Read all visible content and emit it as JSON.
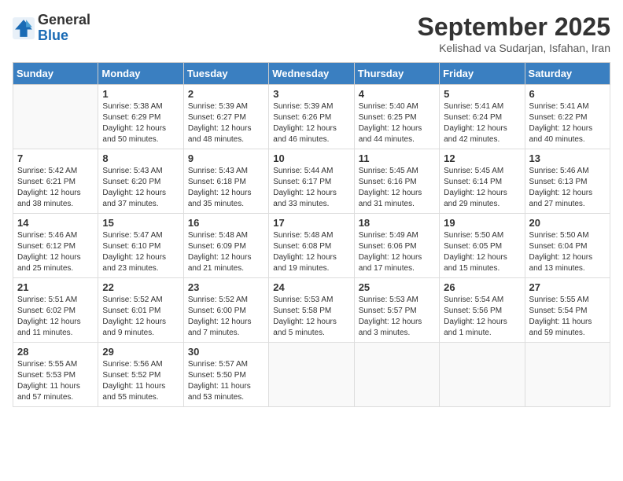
{
  "header": {
    "logo_line1": "General",
    "logo_line2": "Blue",
    "month": "September 2025",
    "location": "Kelishad va Sudarjan, Isfahan, Iran"
  },
  "weekdays": [
    "Sunday",
    "Monday",
    "Tuesday",
    "Wednesday",
    "Thursday",
    "Friday",
    "Saturday"
  ],
  "weeks": [
    [
      {
        "day": "",
        "text": ""
      },
      {
        "day": "1",
        "text": "Sunrise: 5:38 AM\nSunset: 6:29 PM\nDaylight: 12 hours\nand 50 minutes."
      },
      {
        "day": "2",
        "text": "Sunrise: 5:39 AM\nSunset: 6:27 PM\nDaylight: 12 hours\nand 48 minutes."
      },
      {
        "day": "3",
        "text": "Sunrise: 5:39 AM\nSunset: 6:26 PM\nDaylight: 12 hours\nand 46 minutes."
      },
      {
        "day": "4",
        "text": "Sunrise: 5:40 AM\nSunset: 6:25 PM\nDaylight: 12 hours\nand 44 minutes."
      },
      {
        "day": "5",
        "text": "Sunrise: 5:41 AM\nSunset: 6:24 PM\nDaylight: 12 hours\nand 42 minutes."
      },
      {
        "day": "6",
        "text": "Sunrise: 5:41 AM\nSunset: 6:22 PM\nDaylight: 12 hours\nand 40 minutes."
      }
    ],
    [
      {
        "day": "7",
        "text": "Sunrise: 5:42 AM\nSunset: 6:21 PM\nDaylight: 12 hours\nand 38 minutes."
      },
      {
        "day": "8",
        "text": "Sunrise: 5:43 AM\nSunset: 6:20 PM\nDaylight: 12 hours\nand 37 minutes."
      },
      {
        "day": "9",
        "text": "Sunrise: 5:43 AM\nSunset: 6:18 PM\nDaylight: 12 hours\nand 35 minutes."
      },
      {
        "day": "10",
        "text": "Sunrise: 5:44 AM\nSunset: 6:17 PM\nDaylight: 12 hours\nand 33 minutes."
      },
      {
        "day": "11",
        "text": "Sunrise: 5:45 AM\nSunset: 6:16 PM\nDaylight: 12 hours\nand 31 minutes."
      },
      {
        "day": "12",
        "text": "Sunrise: 5:45 AM\nSunset: 6:14 PM\nDaylight: 12 hours\nand 29 minutes."
      },
      {
        "day": "13",
        "text": "Sunrise: 5:46 AM\nSunset: 6:13 PM\nDaylight: 12 hours\nand 27 minutes."
      }
    ],
    [
      {
        "day": "14",
        "text": "Sunrise: 5:46 AM\nSunset: 6:12 PM\nDaylight: 12 hours\nand 25 minutes."
      },
      {
        "day": "15",
        "text": "Sunrise: 5:47 AM\nSunset: 6:10 PM\nDaylight: 12 hours\nand 23 minutes."
      },
      {
        "day": "16",
        "text": "Sunrise: 5:48 AM\nSunset: 6:09 PM\nDaylight: 12 hours\nand 21 minutes."
      },
      {
        "day": "17",
        "text": "Sunrise: 5:48 AM\nSunset: 6:08 PM\nDaylight: 12 hours\nand 19 minutes."
      },
      {
        "day": "18",
        "text": "Sunrise: 5:49 AM\nSunset: 6:06 PM\nDaylight: 12 hours\nand 17 minutes."
      },
      {
        "day": "19",
        "text": "Sunrise: 5:50 AM\nSunset: 6:05 PM\nDaylight: 12 hours\nand 15 minutes."
      },
      {
        "day": "20",
        "text": "Sunrise: 5:50 AM\nSunset: 6:04 PM\nDaylight: 12 hours\nand 13 minutes."
      }
    ],
    [
      {
        "day": "21",
        "text": "Sunrise: 5:51 AM\nSunset: 6:02 PM\nDaylight: 12 hours\nand 11 minutes."
      },
      {
        "day": "22",
        "text": "Sunrise: 5:52 AM\nSunset: 6:01 PM\nDaylight: 12 hours\nand 9 minutes."
      },
      {
        "day": "23",
        "text": "Sunrise: 5:52 AM\nSunset: 6:00 PM\nDaylight: 12 hours\nand 7 minutes."
      },
      {
        "day": "24",
        "text": "Sunrise: 5:53 AM\nSunset: 5:58 PM\nDaylight: 12 hours\nand 5 minutes."
      },
      {
        "day": "25",
        "text": "Sunrise: 5:53 AM\nSunset: 5:57 PM\nDaylight: 12 hours\nand 3 minutes."
      },
      {
        "day": "26",
        "text": "Sunrise: 5:54 AM\nSunset: 5:56 PM\nDaylight: 12 hours\nand 1 minute."
      },
      {
        "day": "27",
        "text": "Sunrise: 5:55 AM\nSunset: 5:54 PM\nDaylight: 11 hours\nand 59 minutes."
      }
    ],
    [
      {
        "day": "28",
        "text": "Sunrise: 5:55 AM\nSunset: 5:53 PM\nDaylight: 11 hours\nand 57 minutes."
      },
      {
        "day": "29",
        "text": "Sunrise: 5:56 AM\nSunset: 5:52 PM\nDaylight: 11 hours\nand 55 minutes."
      },
      {
        "day": "30",
        "text": "Sunrise: 5:57 AM\nSunset: 5:50 PM\nDaylight: 11 hours\nand 53 minutes."
      },
      {
        "day": "",
        "text": ""
      },
      {
        "day": "",
        "text": ""
      },
      {
        "day": "",
        "text": ""
      },
      {
        "day": "",
        "text": ""
      }
    ]
  ]
}
